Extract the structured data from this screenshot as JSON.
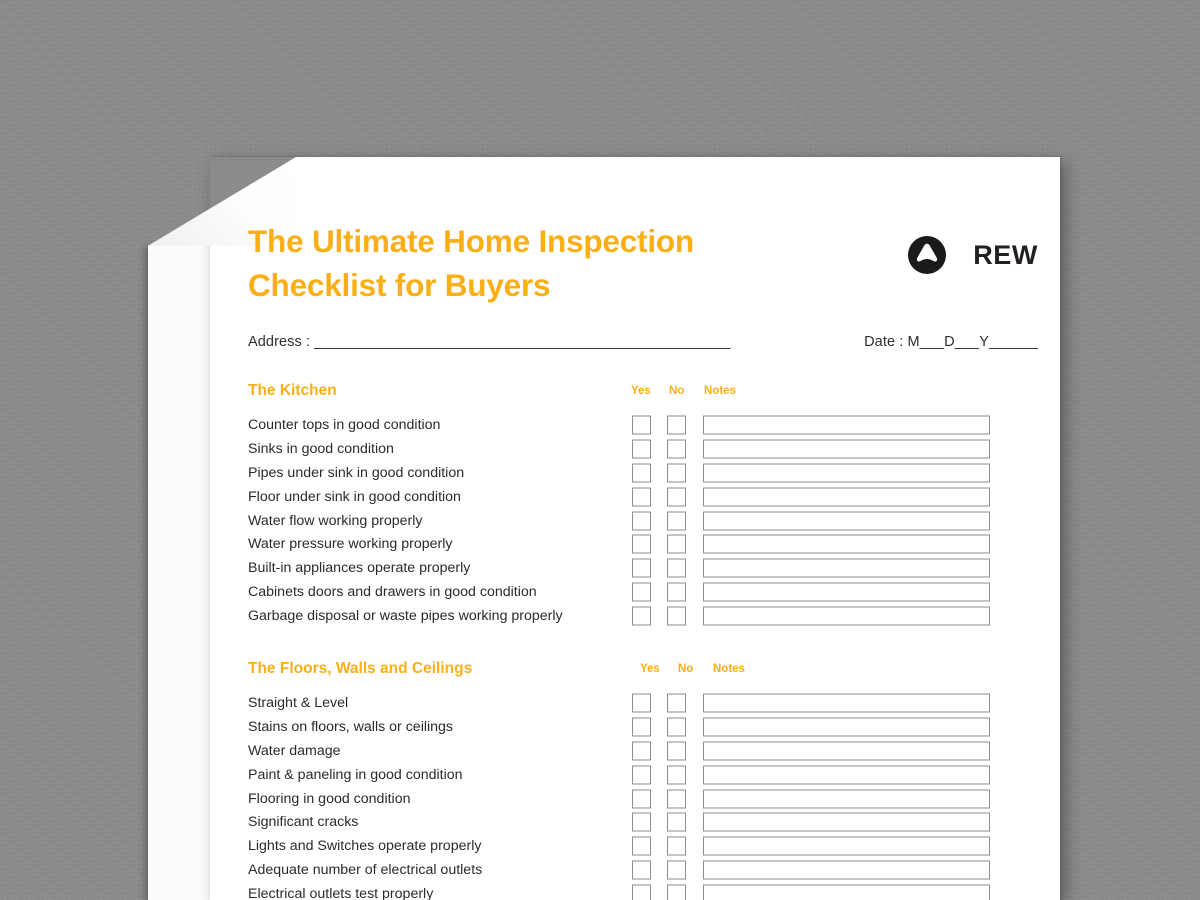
{
  "document": {
    "title": "The Ultimate Home Inspection\nChecklist for Buyers",
    "brand_name": "REW",
    "brand_logo_icon": "rew-triangle-logo-icon",
    "accent_color": "#fbaf17",
    "text_color": "#2b2b2b",
    "background_color": "#8c8c8c",
    "page_color": "#ffffff",
    "border_color": "#8d8d8d"
  },
  "meta": {
    "address_label": "Address : ",
    "address_line": "___________________________________________________",
    "date_label": "Date : ",
    "date_line": "M___D___Y______"
  },
  "columns": {
    "yes": "Yes",
    "no": "No",
    "notes": "Notes"
  },
  "sections": [
    {
      "title": "The Kitchen",
      "items": [
        "Counter tops in good condition",
        "Sinks in good condition",
        "Pipes under sink in good condition",
        "Floor under sink in good condition",
        "Water flow working properly",
        "Water pressure working properly",
        "Built-in appliances operate properly",
        "Cabinets doors and drawers in good condition",
        "Garbage disposal or waste pipes working properly"
      ]
    },
    {
      "title": "The Floors, Walls and Ceilings",
      "items": [
        "Straight & Level",
        "Stains on floors, walls or ceilings",
        "Water damage",
        "Paint & paneling in good condition",
        "Flooring in good condition",
        "Significant cracks",
        "Lights and Switches operate properly",
        "Adequate number of electrical outlets",
        "Electrical outlets test properly"
      ]
    }
  ]
}
